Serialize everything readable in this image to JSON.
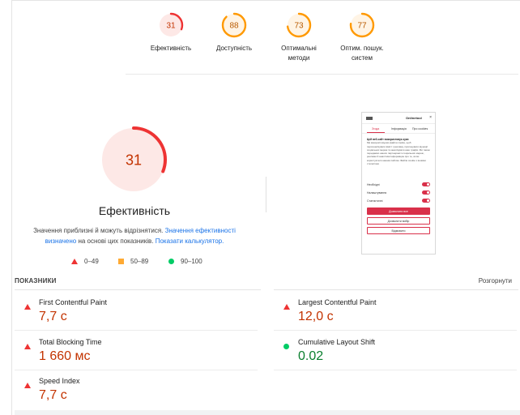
{
  "gauges": [
    {
      "score": "31",
      "label_l1": "Ефективність",
      "label_l2": "",
      "color": "#e33",
      "bg": "#fde8e6",
      "value": 0.31
    },
    {
      "score": "88",
      "label_l1": "Доступність",
      "label_l2": "",
      "color": "#f90",
      "bg": "#fff4e5",
      "value": 0.88
    },
    {
      "score": "73",
      "label_l1": "Оптимальні",
      "label_l2": "методи",
      "color": "#f90",
      "bg": "#fff4e5",
      "value": 0.73
    },
    {
      "score": "77",
      "label_l1": "Оптим. пошук.",
      "label_l2": "систем",
      "color": "#f90",
      "bg": "#fff4e5",
      "value": 0.77
    }
  ],
  "main": {
    "score": "31",
    "value": 0.31,
    "title": "Ефективність",
    "desc_1": "Значення приблизні й можуть відрізнятися. ",
    "desc_link1": "Значення ефективності визначено",
    "desc_2": " на основі цих показників. ",
    "desc_link2": "Показати калькулятор."
  },
  "legend": {
    "bad": "0–49",
    "avg": "50–89",
    "good": "90–100"
  },
  "colors": {
    "red": "#e33",
    "orange": "#fa3",
    "green": "#0c6",
    "brand": "#d9304a"
  },
  "phone": {
    "logo": "Onlinetool",
    "tabs": [
      "Згода",
      "Інформація",
      "Про cookies"
    ],
    "text_title": "Цей веб-сайт використовує куки",
    "text_body": "Ми використовуємо файли cookie, щоб персоналізувати вміст і рекламу, пропонувати функції соціальних мереж та аналізувати наш трафік. Ми також передаємо наших партнерам із соціальних мереж, реклами й аналітики інформацію про те, як ви користуєтеся нашим сайтом. Файли cookie з іншими статистики",
    "rows": [
      "Необхідні",
      "Налаштування",
      "Статистичні"
    ],
    "btn_allow_all": "Дозволити все",
    "btn_allow_sel": "Дозволити вибір",
    "btn_deny": "Відмовити"
  },
  "metrics": {
    "header": "ПОКАЗНИКИ",
    "expand": "Розгорнути",
    "items": [
      {
        "name": "First Contentful Paint",
        "value": "7,7 с",
        "status": "bad"
      },
      {
        "name": "Largest Contentful Paint",
        "value": "12,0 с",
        "status": "bad"
      },
      {
        "name": "Total Blocking Time",
        "value": "1 660 мс",
        "status": "bad"
      },
      {
        "name": "Cumulative Layout Shift",
        "value": "0.02",
        "status": "good"
      },
      {
        "name": "Speed Index",
        "value": "7,7 с",
        "status": "bad"
      }
    ]
  }
}
